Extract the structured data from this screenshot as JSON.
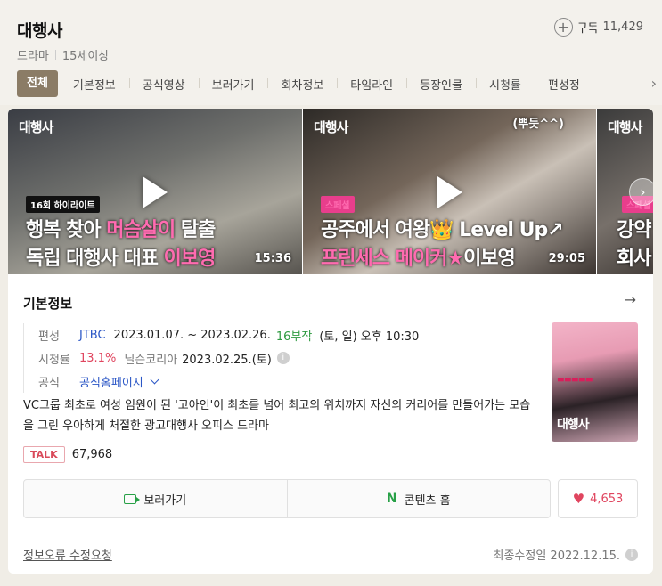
{
  "header": {
    "title": "대행사",
    "genre": "드라마",
    "rating": "15세이상",
    "subscribe_label": "구독",
    "subscribe_count": "11,429"
  },
  "tabs": [
    "전체",
    "기본정보",
    "공식영상",
    "보러가기",
    "회차정보",
    "타임라인",
    "등장인물",
    "시청률",
    "편성정"
  ],
  "videos": [
    {
      "logo": "대행사",
      "tag": "16회 하이라이트",
      "line1_a": "행복 찾아 ",
      "line1_b": "머슴살이",
      "line1_c": " 탈출",
      "line2_a": "독립 대행사 대표 ",
      "line2_b": "이보영",
      "duration": "15:36"
    },
    {
      "logo": "대행사",
      "note": "(뿌듯^^)",
      "tag": "스페셜",
      "line1_a": "공주에서 여왕",
      "line1_b": "👑",
      "line1_c": " Level Up↗",
      "line2_a": "프린세스 메이커★",
      "line2_b": "이보영",
      "duration": "29:05"
    },
    {
      "logo": "대행사",
      "tag": "스페셜",
      "line1": "강약",
      "line2": "회사"
    }
  ],
  "info": {
    "title": "기본정보",
    "broadcast_label": "편성",
    "channel": "JTBC",
    "period": "2023.01.07. ~ 2023.02.26.",
    "episodes": "16부작",
    "schedule": "(토, 일) 오후 10:30",
    "rating_label": "시청률",
    "rating_value": "13.1%",
    "rating_source": "닐슨코리아",
    "rating_date": "2023.02.25.(토)",
    "official_label": "공식",
    "official_link": "공식홈페이지",
    "description": "VC그룹 최초로 여성 임원이 된 '고아인'이 최초를 넘어 최고의 위치까지 자신의 커리어를 만들어가는 모습을 그린 우아하게 처절한 광고대행사 오피스 드라마",
    "talk_badge": "TALK",
    "talk_count": "67,968",
    "poster_logo": "대행사"
  },
  "actions": {
    "watch": "보러가기",
    "content_home": "콘텐츠 홈",
    "like_count": "4,653"
  },
  "footer": {
    "report": "정보오류 수정요청",
    "updated": "최종수정일 2022.12.15."
  },
  "colors": {
    "accent_tab": "#8b7c66",
    "link_blue": "#2a56c6",
    "green": "#2e9a40",
    "red": "#e0455f"
  }
}
